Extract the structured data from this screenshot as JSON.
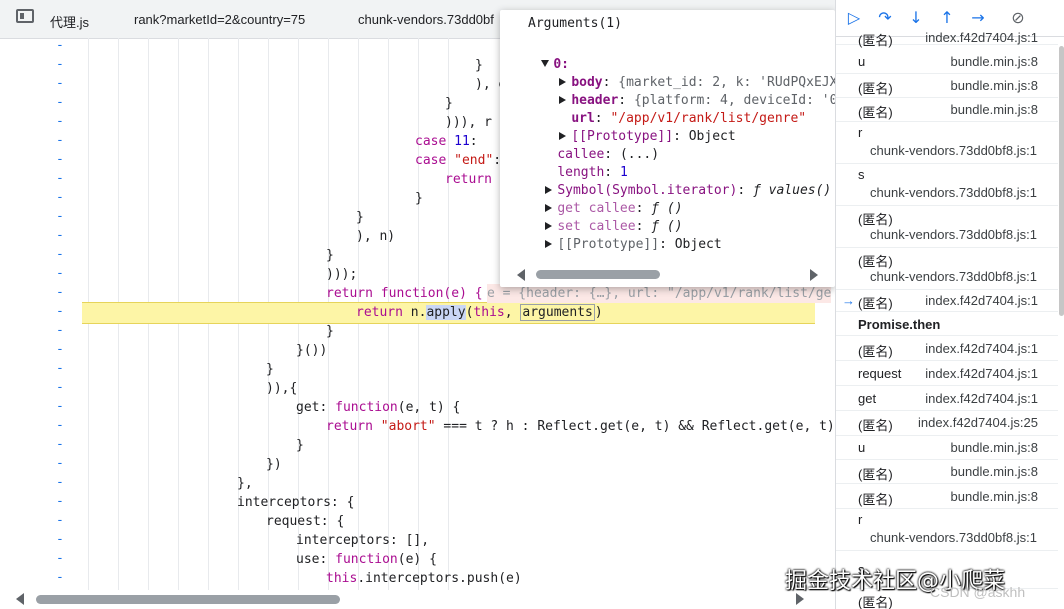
{
  "tabs": {
    "t1": "代理.js",
    "t2": "rank?marketId=2&country=75",
    "t3": "chunk-vendors.73dd0bf",
    "more": "»"
  },
  "code_lines": [
    "}",
    "), e",
    "}",
    "))), r",
    "case 11:",
    "case \"end\":",
    "return r",
    "}",
    "}",
    "), n)",
    "}",
    ")));",
    "return function(e) {",
    "return n.apply(this, arguments)",
    "}",
    "}())",
    "}",
    ")),{",
    "get: function(e, t) {",
    "return \"abort\" === t ? h : Reflect.get(e, t) && Reflect.get(e, t).",
    "}",
    "})",
    "},",
    "interceptors: {",
    "request: {",
    "interceptors: [],",
    "use: function(e) {",
    "this.interceptors.push(e)"
  ],
  "inline_value": "e = {header: {…}, url: \"/app/v1/rank/list/ge",
  "tooltip": {
    "title": "Arguments(1)",
    "idx": "0:",
    "body_k": "body",
    "body_v": "{market_id: 2, k: 'RUdPQxEJX1lBWk",
    "header_k": "header",
    "header_v": "{platform: 4, deviceId: '08bac6",
    "url_k": "url",
    "url_v": "\"/app/v1/rank/list/genre\"",
    "proto1_k": "[[Prototype]]",
    "proto1_v": "Object",
    "callee_k": "callee",
    "callee_v": "(...)",
    "length_k": "length",
    "length_v": "1",
    "sym_k": "Symbol(Symbol.iterator)",
    "sym_v": "ƒ values()",
    "getc_k": "get callee",
    "getc_v": "ƒ ()",
    "setc_k": "set callee",
    "setc_v": "ƒ ()",
    "proto2_k": "[[Prototype]]",
    "proto2_v": "Object"
  },
  "callstack": [
    {
      "name": "(匿名)",
      "loc": "index.f42d7404.js:1"
    },
    {
      "name": "u",
      "loc": "bundle.min.js:8"
    },
    {
      "name": "(匿名)",
      "loc": "bundle.min.js:8"
    },
    {
      "name": "(匿名)",
      "loc": "bundle.min.js:8"
    },
    {
      "name": "r",
      "loc": "chunk-vendors.73dd0bf8.js:1"
    },
    {
      "name": "s",
      "loc": "chunk-vendors.73dd0bf8.js:1"
    },
    {
      "name": "(匿名)",
      "loc": "chunk-vendors.73dd0bf8.js:1"
    },
    {
      "name": "(匿名)",
      "loc": "chunk-vendors.73dd0bf8.js:1"
    },
    {
      "name": "(匿名)",
      "loc": "index.f42d7404.js:1"
    },
    {
      "name": "Promise.then",
      "loc": ""
    },
    {
      "name": "(匿名)",
      "loc": "index.f42d7404.js:1"
    },
    {
      "name": "request",
      "loc": "index.f42d7404.js:1"
    },
    {
      "name": "get",
      "loc": "index.f42d7404.js:1"
    },
    {
      "name": "(匿名)",
      "loc": "index.f42d7404.js:25"
    },
    {
      "name": "u",
      "loc": "bundle.min.js:8"
    },
    {
      "name": "(匿名)",
      "loc": "bundle.min.js:8"
    },
    {
      "name": "(匿名)",
      "loc": "bundle.min.js:8"
    },
    {
      "name": "r",
      "loc": "chunk-vendors.73dd0bf8.js:1"
    },
    {
      "name": "s",
      "loc": ""
    },
    {
      "name": "(匿名)",
      "loc": ""
    }
  ],
  "watermark": "掘金技术社区@小爬菜",
  "watermark2": "CSDN @askhh",
  "colors": {
    "keyword": "#aa0d91",
    "string": "#c41a16",
    "number": "#1c00cf",
    "highlight": "#fdf5a6",
    "accent": "#1a73e8"
  }
}
